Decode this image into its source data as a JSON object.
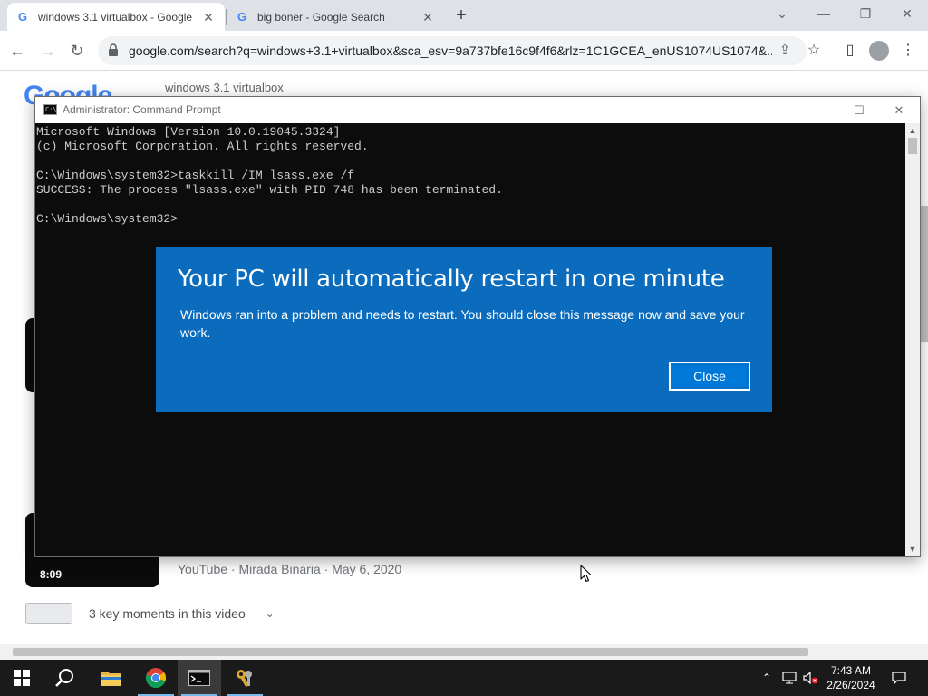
{
  "browser": {
    "tabs": [
      {
        "title": "windows 3.1 virtualbox - Google",
        "active": true
      },
      {
        "title": "big boner - Google Search",
        "active": false
      }
    ],
    "url": "google.com/search?q=windows+3.1+virtualbox&sca_esv=9a737bfe16c9f4f6&rlz=1C1GCEA_enUS1074US1074&...",
    "search_query": "windows 3.1 virtualbox",
    "logo_text": "Google"
  },
  "page": {
    "video_duration": "8:09",
    "video_meta": "YouTube · Mirada Binaria · May 6, 2020",
    "moments_text": "3 key moments in this video"
  },
  "cmd": {
    "title": "Administrator: Command Prompt",
    "output": "Microsoft Windows [Version 10.0.19045.3324]\n(c) Microsoft Corporation. All rights reserved.\n\nC:\\Windows\\system32>taskkill /IM lsass.exe /f\nSUCCESS: The process \"lsass.exe\" with PID 748 has been terminated.\n\nC:\\Windows\\system32>"
  },
  "restart_dialog": {
    "title": "Your PC will automatically restart in one minute",
    "message": "Windows ran into a problem and needs to restart. You should close this message now and save your work.",
    "close_label": "Close",
    "background_color": "#0b6cbd"
  },
  "taskbar": {
    "apps": [
      "windows-start",
      "search",
      "file-explorer",
      "chrome",
      "command-prompt",
      "key-app"
    ],
    "time": "7:43 AM",
    "date": "2/26/2024"
  }
}
